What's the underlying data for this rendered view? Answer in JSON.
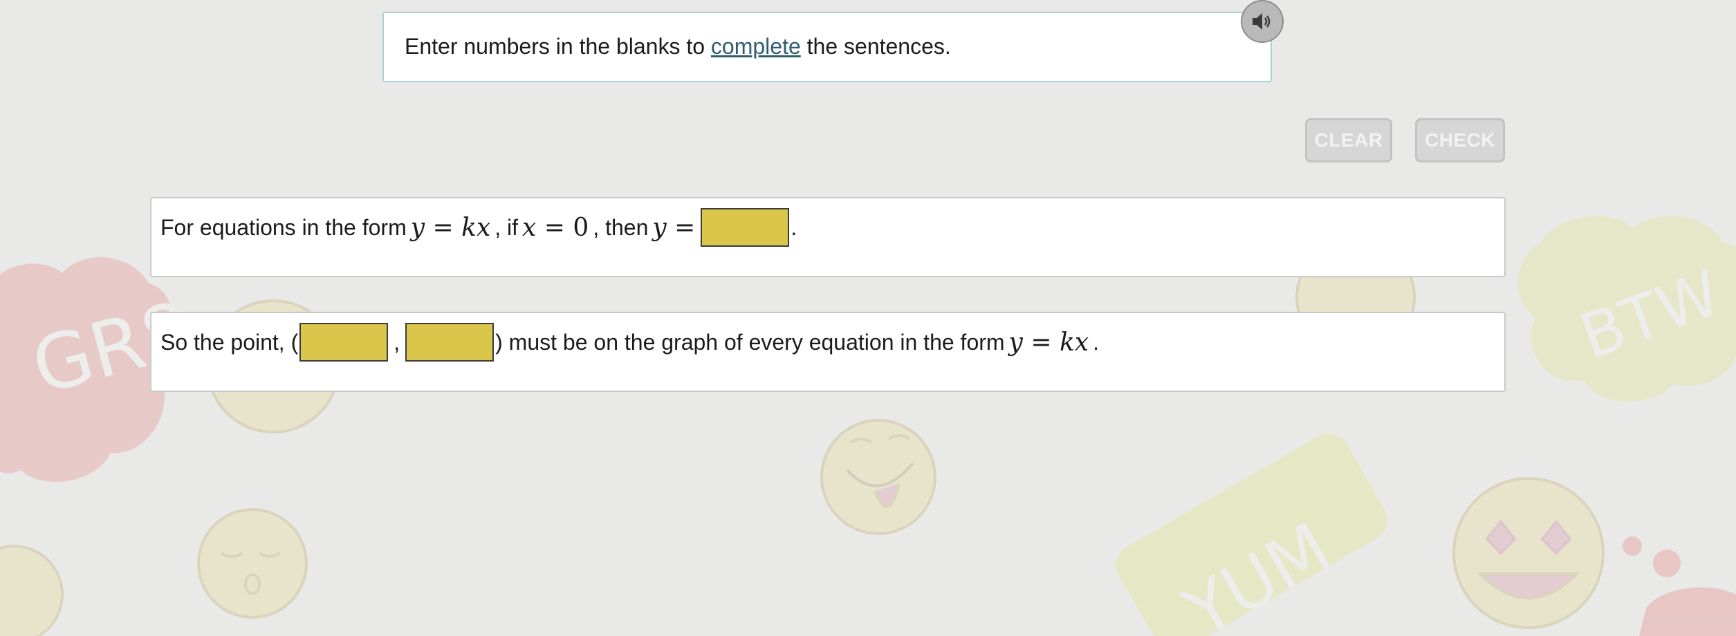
{
  "colors": {
    "background": "#e9e9e8",
    "instruction_border": "#a7d3d3",
    "link": "#2f5d6e",
    "blank_fill": "#d9c64a",
    "button_disabled": "#d6d6d6"
  },
  "background_decor": {
    "stickers": [
      "GR8",
      "YUM",
      "BTW"
    ],
    "icons": [
      "tongue-out-emoji-icon",
      "heart-eyes-emoji-icon",
      "sleeping-emoji-icon",
      "smiley-emoji-icon"
    ]
  },
  "instruction": {
    "prefix": "Enter numbers in the blanks to ",
    "link": "complete",
    "suffix": " the sentences."
  },
  "audio": {
    "icon": "speaker-icon"
  },
  "toolbar": {
    "clear_label": "CLEAR",
    "check_label": "CHECK"
  },
  "question1": {
    "text1": "For equations in the form",
    "math1_left": "y",
    "math1_eq": " = ",
    "math1_right": "kx",
    "text2": ", if",
    "math2_left": "x",
    "math2_eq": " = ",
    "math2_right": "0",
    "text3": ", then",
    "math3_left": "y",
    "math3_eq": " =",
    "blank_value": "",
    "end": "."
  },
  "question2": {
    "text1": "So the point, (",
    "blank_x_value": "",
    "comma": ",",
    "blank_y_value": "",
    "text2": ") must be on the graph of every equation in the form",
    "math_left": "y",
    "math_eq": " = ",
    "math_right": "kx",
    "end": "."
  }
}
